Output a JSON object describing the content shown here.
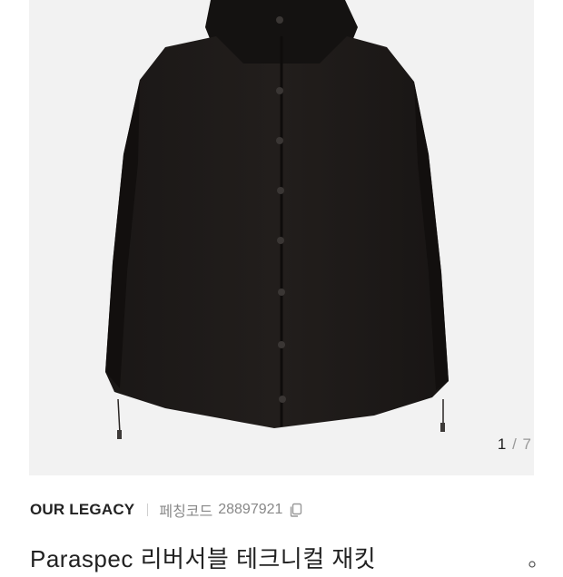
{
  "gallery": {
    "image_alt": "black hooded snap-button jacket",
    "current_page": "1",
    "separator": "/",
    "total_pages": "7"
  },
  "product": {
    "brand": "OUR LEGACY",
    "code_label": "페칭코드",
    "code_value": "28897921",
    "title": "Paraspec 리버서블 테크니컬 재킷"
  },
  "colors": {
    "background": "#ffffff",
    "image_bg": "#f2f2f2",
    "text_primary": "#222222",
    "text_secondary": "#888888"
  }
}
